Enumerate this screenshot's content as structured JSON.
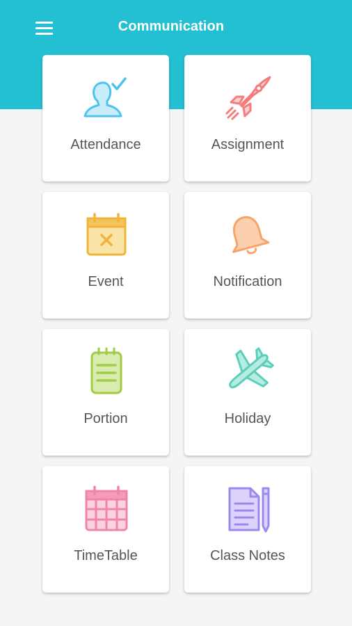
{
  "header": {
    "title": "Communication",
    "background_color": "#22c0d2",
    "menu_icon": "hamburger-menu-icon"
  },
  "tiles": [
    {
      "label": "Attendance",
      "icon": "person-check-icon",
      "color": "#5bc8f0"
    },
    {
      "label": "Assignment",
      "icon": "rocket-icon",
      "color": "#f47c7c"
    },
    {
      "label": "Event",
      "icon": "calendar-x-icon",
      "color": "#f3b63b"
    },
    {
      "label": "Notification",
      "icon": "bell-icon",
      "color": "#f6a86e"
    },
    {
      "label": "Portion",
      "icon": "notepad-icon",
      "color": "#a5cd4a"
    },
    {
      "label": "Holiday",
      "icon": "airplane-icon",
      "color": "#5fd3bc"
    },
    {
      "label": "TimeTable",
      "icon": "calendar-grid-icon",
      "color": "#f38bab"
    },
    {
      "label": "Class Notes",
      "icon": "document-pen-icon",
      "color": "#a48ff0"
    }
  ]
}
